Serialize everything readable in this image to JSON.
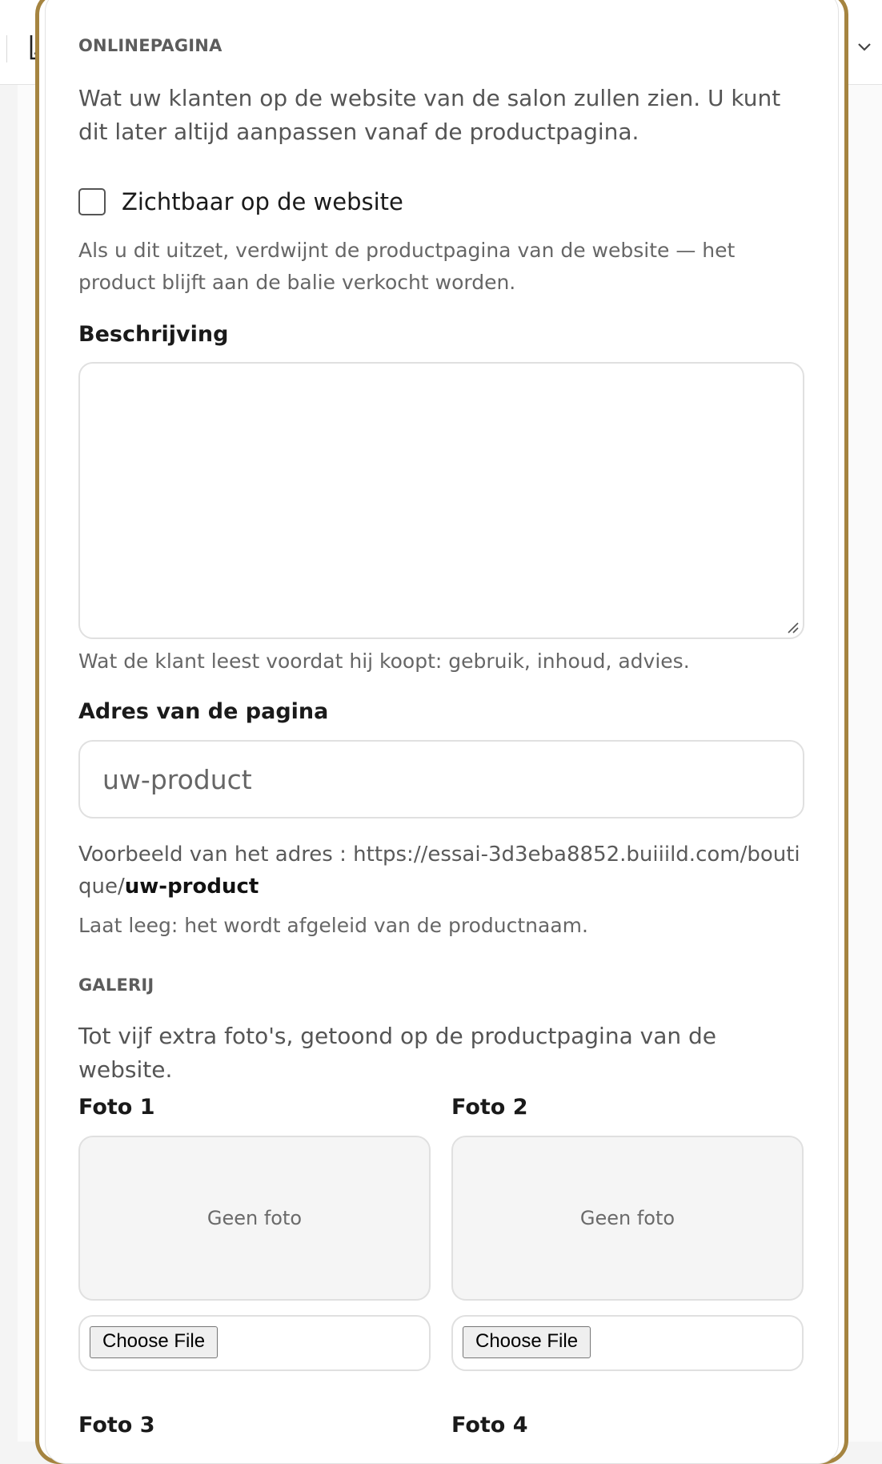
{
  "online": {
    "eyebrow": "ONLINEPAGINA",
    "intro": "Wat uw klanten op de website van de salon zullen zien. U kunt dit later altijd aanpassen vanaf de productpagina.",
    "visible_label": "Zichtbaar op de website",
    "visible_checked": false,
    "visible_help": "Als u dit uitzet, verdwijnt de productpagina van de website — het product blijft aan de balie verkocht worden.",
    "description_label": "Beschrijving",
    "description_value": "",
    "description_help": "Wat de klant leest voordat hij koopt: gebruik, inhoud, advies.",
    "address_label": "Adres van de pagina",
    "address_placeholder": "uw-product",
    "address_preview_prefix": "Voorbeeld van het adres : https://essai-3d3eba8852.buiiild.com/boutique/",
    "address_preview_slug": "uw-product",
    "address_help": "Laat leeg: het wordt afgeleid van de productnaam."
  },
  "gallery": {
    "eyebrow": "GALERIJ",
    "intro": "Tot vijf extra foto's, getoond op de productpagina van de website.",
    "photos": [
      {
        "label": "Foto 1",
        "empty_text": "Geen foto",
        "button": "Choose File"
      },
      {
        "label": "Foto 2",
        "empty_text": "Geen foto",
        "button": "Choose File"
      },
      {
        "label": "Foto 3"
      },
      {
        "label": "Foto 4"
      }
    ]
  },
  "colors": {
    "dialog_border": "#a58440",
    "page_background": "#f4f4f4"
  },
  "icons": {
    "topbar_left": "chart-icon",
    "topbar_right": "chevron-down-icon"
  }
}
